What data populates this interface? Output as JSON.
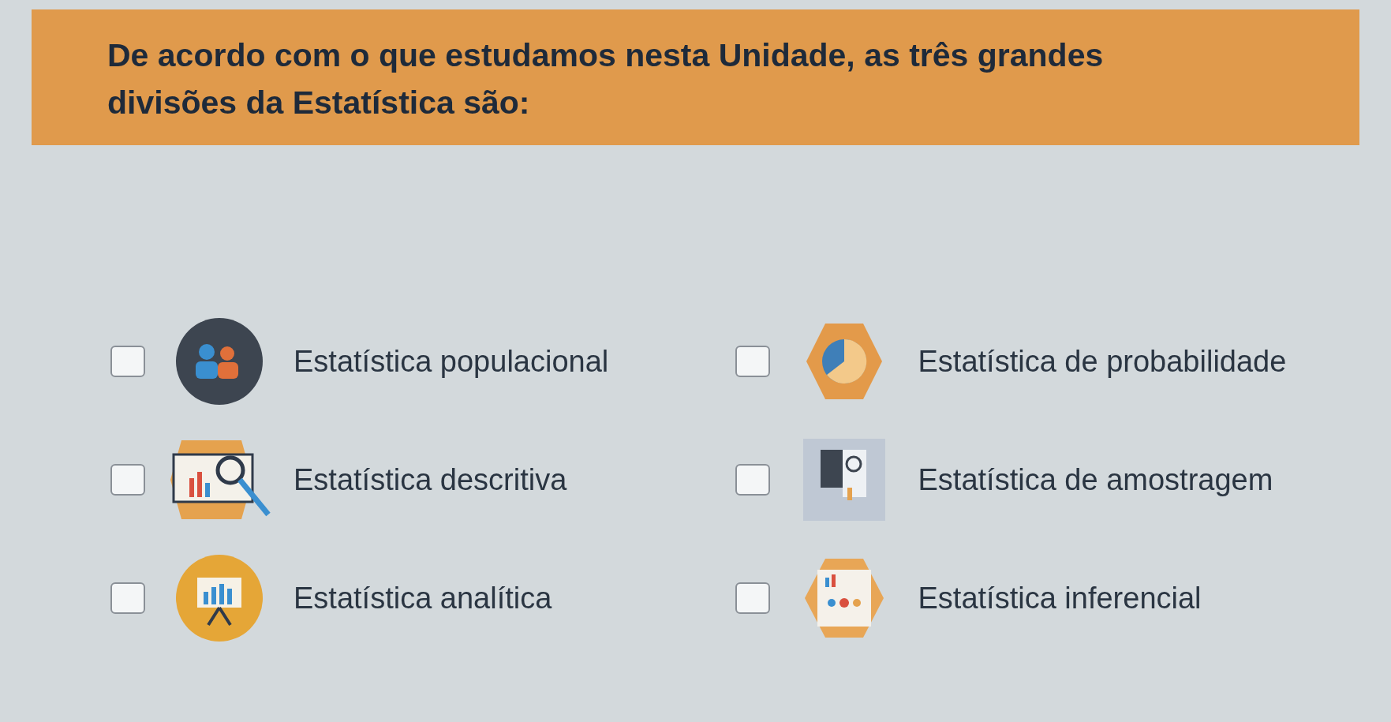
{
  "question": {
    "text": "De acordo com o que estudamos nesta Unidade, as três grandes divisões da Estatística são:"
  },
  "options": [
    {
      "label": "Estatística populacional",
      "checked": false,
      "kind": "people"
    },
    {
      "label": "Estatística de probabilidade",
      "checked": false,
      "kind": "percent"
    },
    {
      "label": "Estatística descritiva",
      "checked": false,
      "kind": "magnifier"
    },
    {
      "label": "Estatística de amostragem",
      "checked": false,
      "kind": "document"
    },
    {
      "label": "Estatística analítica",
      "checked": false,
      "kind": "presentation"
    },
    {
      "label": "Estatística inferencial",
      "checked": false,
      "kind": "infographic"
    }
  ]
}
